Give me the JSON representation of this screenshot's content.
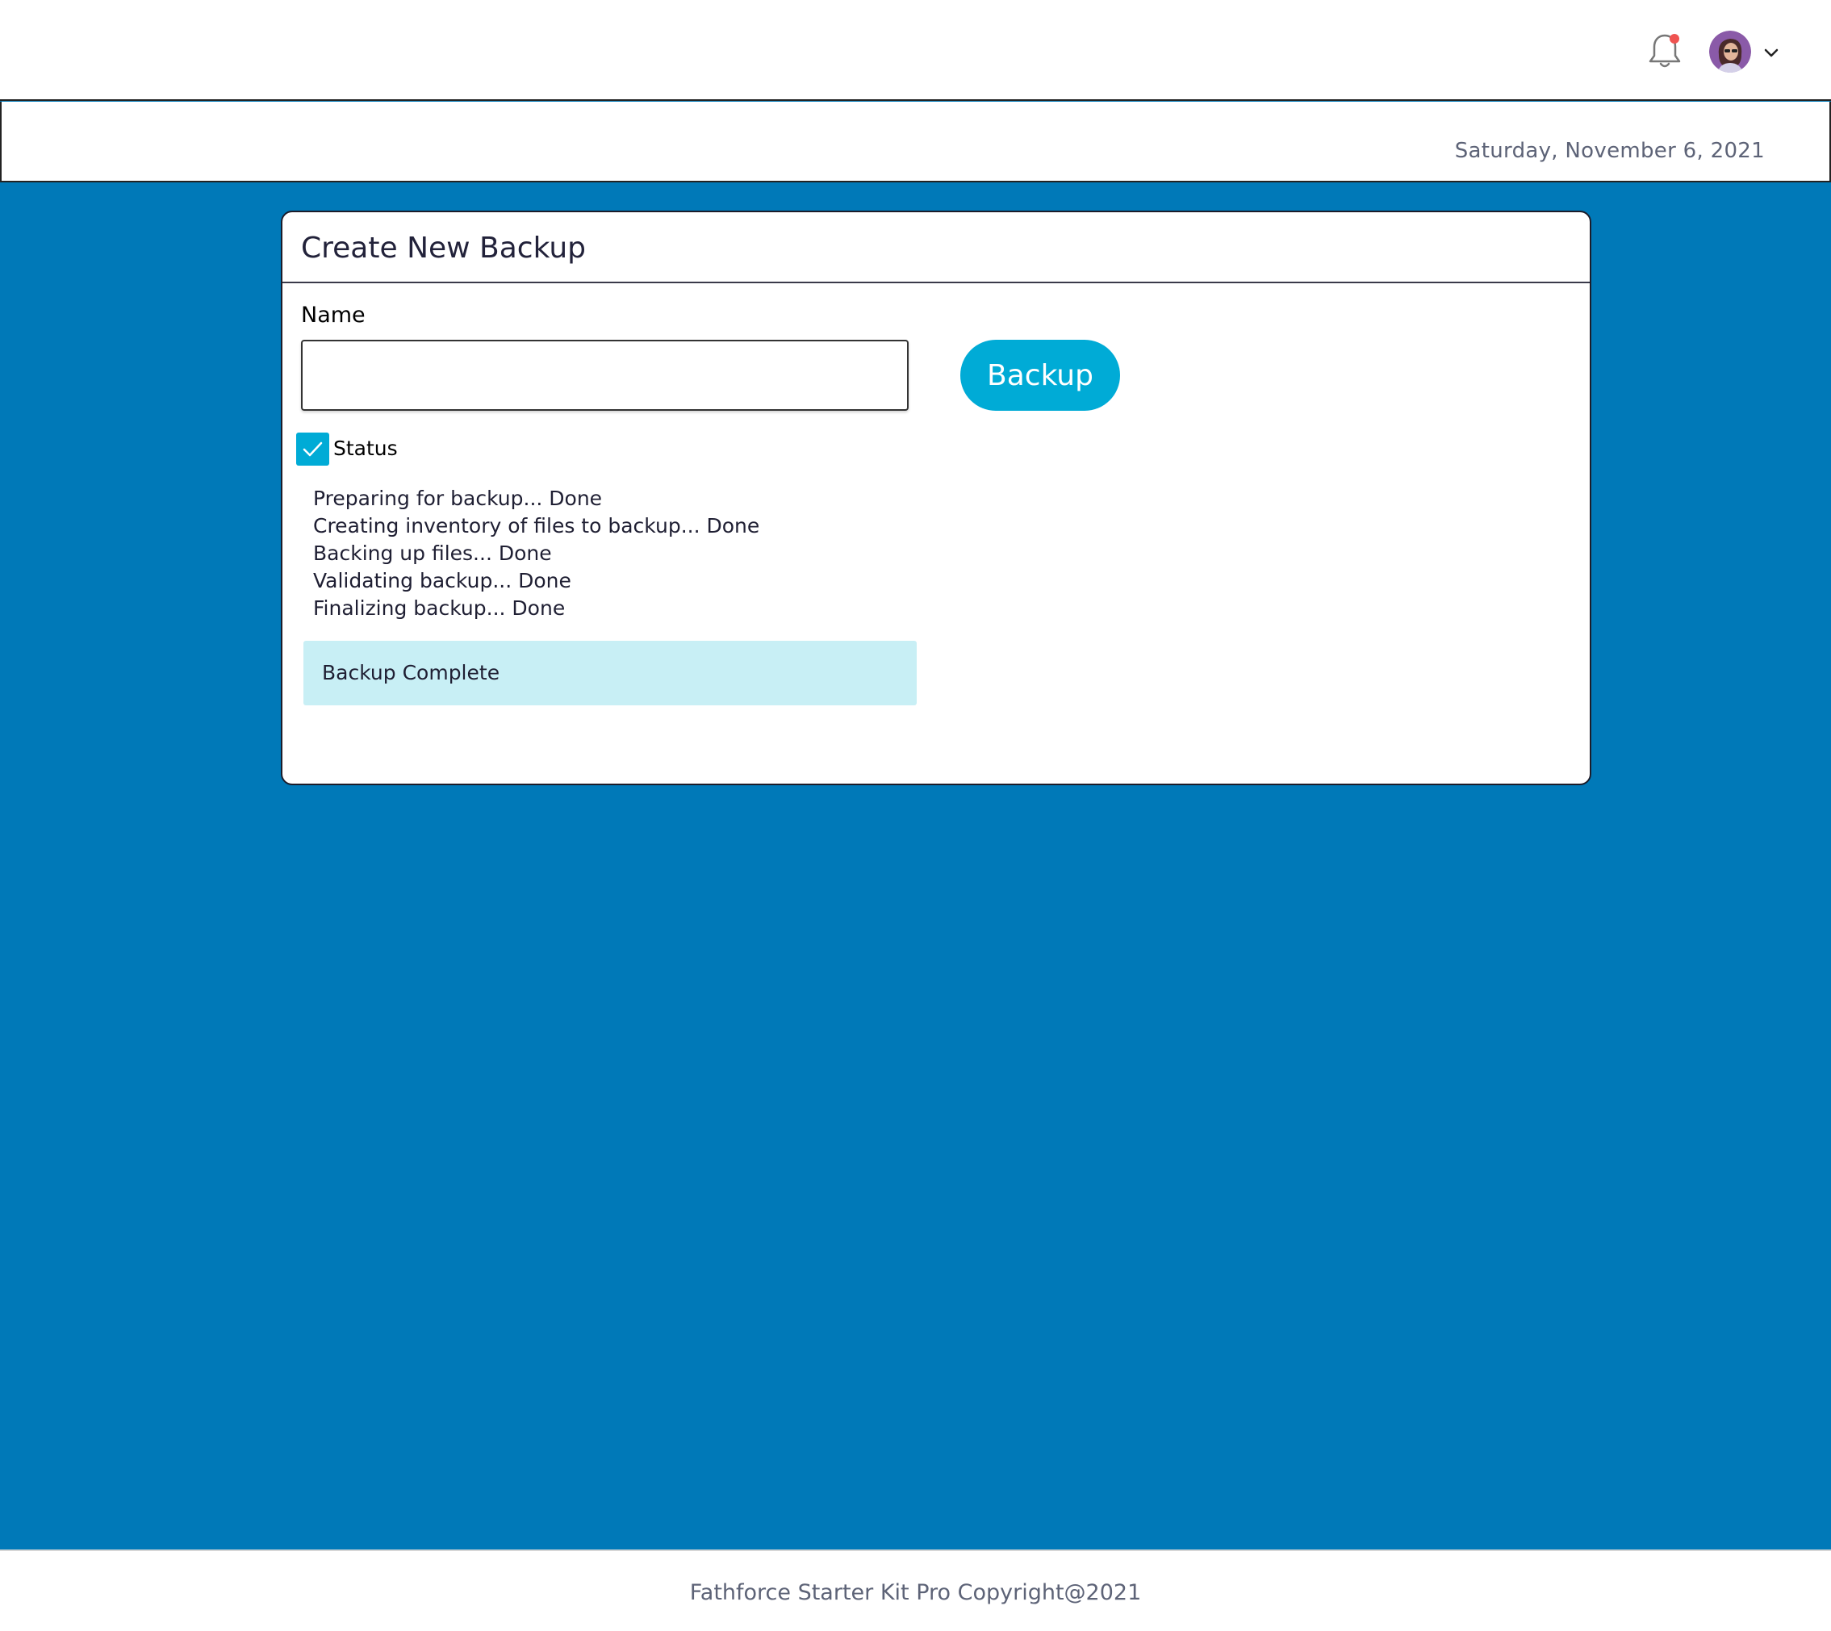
{
  "header": {
    "notification_icon": "bell-icon",
    "notification_badge_color": "#ef5350",
    "avatar_icon": "user-avatar",
    "menu_icon": "chevron-down-icon"
  },
  "date_bar": {
    "date": "Saturday, November 6, 2021"
  },
  "backup_card": {
    "title": "Create New Backup",
    "name_label": "Name",
    "name_value": "",
    "backup_button_label": "Backup",
    "status_checkbox_checked": true,
    "status_label": "Status",
    "log_lines": [
      "Preparing for backup... Done",
      "Creating inventory of files to backup... Done",
      "Backing up files... Done",
      "Validating backup... Done",
      "Finalizing backup... Done"
    ],
    "result_message": "Backup Complete"
  },
  "footer": {
    "copyright": "Fathforce Starter Kit Pro Copyright@2021"
  },
  "colors": {
    "page_background": "#0079b8",
    "accent": "#00abd6",
    "alert_background": "#c8eff5",
    "muted_text": "#5d6377"
  }
}
